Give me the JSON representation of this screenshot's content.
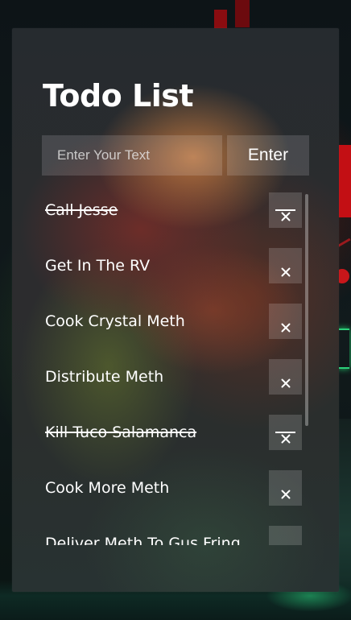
{
  "app": {
    "title": "Todo List"
  },
  "form": {
    "input_placeholder": "Enter Your Text",
    "input_value": "",
    "submit_label": "Enter"
  },
  "todos": [
    {
      "text": "Call Jesse",
      "completed": true
    },
    {
      "text": "Get In The RV",
      "completed": false
    },
    {
      "text": "Cook Crystal Meth",
      "completed": false
    },
    {
      "text": "Distribute Meth",
      "completed": false
    },
    {
      "text": "Kill Tuco Salamanca",
      "completed": true
    },
    {
      "text": "Cook More Meth",
      "completed": false
    },
    {
      "text": "Deliver Meth To Gus Fring",
      "completed": false
    }
  ],
  "icons": {
    "delete": "close-icon"
  },
  "colors": {
    "text": "#ffffff",
    "control_bg": "rgba(255,255,255,0.14)"
  }
}
